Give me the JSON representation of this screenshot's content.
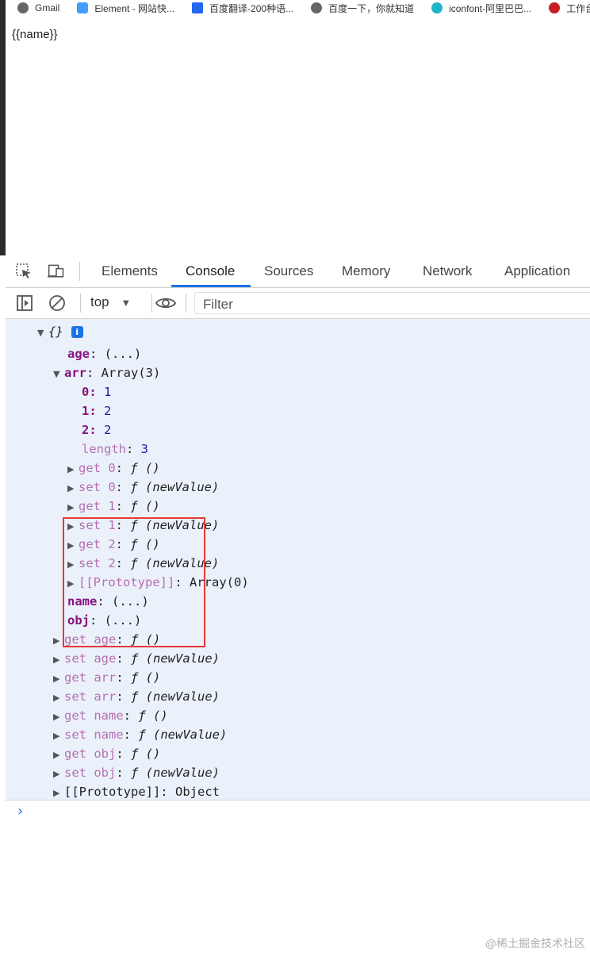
{
  "bookmarks": [
    {
      "label": "Gmail",
      "icon": "gmail-icon",
      "color": "#555555"
    },
    {
      "label": "Element - 网站快...",
      "icon": "element-icon",
      "color": "#409eff"
    },
    {
      "label": "百度翻译-200种语...",
      "icon": "baidu-translate-icon",
      "color": "#2468f2"
    },
    {
      "label": "百度一下，你就知道",
      "icon": "globe-icon",
      "color": "#555555"
    },
    {
      "label": "iconfont-阿里巴巴...",
      "icon": "iconfont-icon",
      "color": "#1fb5c9"
    },
    {
      "label": "工作台",
      "icon": "gitee-icon",
      "color": "#c71d23"
    }
  ],
  "page": {
    "template_text": "{{name}}"
  },
  "devtools": {
    "tabs": [
      "Elements",
      "Console",
      "Sources",
      "Memory",
      "Network",
      "Application"
    ],
    "active_tab": "Console",
    "toolbar": {
      "context": "top",
      "filter_placeholder": "Filter"
    },
    "object": {
      "header": "{}",
      "info": "i",
      "lines": [
        {
          "k": "age",
          "v": ": (...)"
        },
        {
          "k": "arr",
          "v": ": Array(3)"
        },
        {
          "k": "0",
          "v": "1"
        },
        {
          "k": "1",
          "v": "2"
        },
        {
          "k": "2",
          "v": "2"
        },
        {
          "k": "length",
          "v": "3"
        },
        {
          "k": "get 0",
          "v": "ƒ ()"
        },
        {
          "k": "set 0",
          "v": "ƒ (newValue)"
        },
        {
          "k": "get 1",
          "v": "ƒ ()"
        },
        {
          "k": "set 1",
          "v": "ƒ (newValue)"
        },
        {
          "k": "get 2",
          "v": "ƒ ()"
        },
        {
          "k": "set 2",
          "v": "ƒ (newValue)"
        },
        {
          "k": "[[Prototype]]",
          "v": "Array(0)"
        },
        {
          "k": "name",
          "v": ": (...)"
        },
        {
          "k": "obj",
          "v": ": (...)"
        },
        {
          "k": "get age",
          "v": "ƒ ()"
        },
        {
          "k": "set age",
          "v": "ƒ (newValue)"
        },
        {
          "k": "get arr",
          "v": "ƒ ()"
        },
        {
          "k": "set arr",
          "v": "ƒ (newValue)"
        },
        {
          "k": "get name",
          "v": "ƒ ()"
        },
        {
          "k": "set name",
          "v": "ƒ (newValue)"
        },
        {
          "k": "get obj",
          "v": "ƒ ()"
        },
        {
          "k": "set obj",
          "v": "ƒ (newValue)"
        },
        {
          "k": "[[Prototype]]",
          "v": "Object"
        }
      ]
    },
    "prompt": "›"
  },
  "watermark": "@稀土掘金技术社区"
}
